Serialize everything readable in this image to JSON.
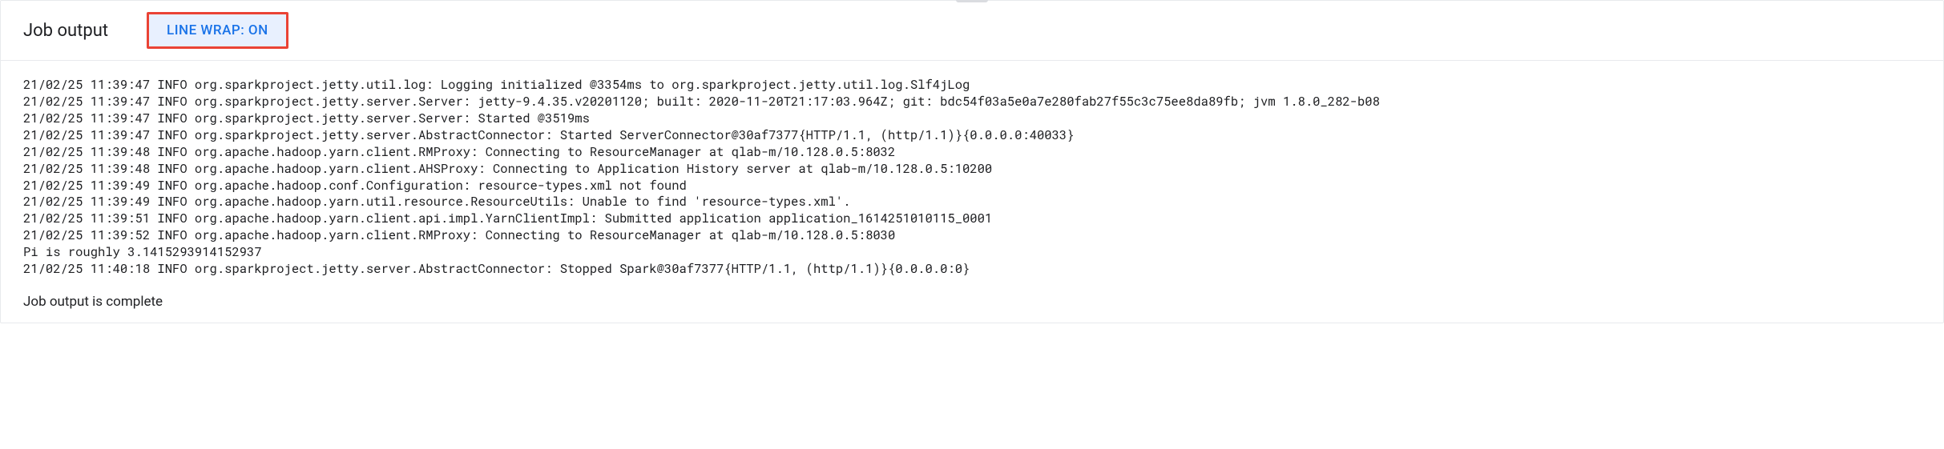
{
  "header": {
    "title": "Job output",
    "lineWrapToggleLabel": "LINE WRAP: ON"
  },
  "log": {
    "lines": [
      "21/02/25 11:39:47 INFO org.sparkproject.jetty.util.log: Logging initialized @3354ms to org.sparkproject.jetty.util.log.Slf4jLog",
      "21/02/25 11:39:47 INFO org.sparkproject.jetty.server.Server: jetty-9.4.35.v20201120; built: 2020-11-20T21:17:03.964Z; git: bdc54f03a5e0a7e280fab27f55c3c75ee8da89fb; jvm 1.8.0_282-b08",
      "21/02/25 11:39:47 INFO org.sparkproject.jetty.server.Server: Started @3519ms",
      "21/02/25 11:39:47 INFO org.sparkproject.jetty.server.AbstractConnector: Started ServerConnector@30af7377{HTTP/1.1, (http/1.1)}{0.0.0.0:40033}",
      "21/02/25 11:39:48 INFO org.apache.hadoop.yarn.client.RMProxy: Connecting to ResourceManager at qlab-m/10.128.0.5:8032",
      "21/02/25 11:39:48 INFO org.apache.hadoop.yarn.client.AHSProxy: Connecting to Application History server at qlab-m/10.128.0.5:10200",
      "21/02/25 11:39:49 INFO org.apache.hadoop.conf.Configuration: resource-types.xml not found",
      "21/02/25 11:39:49 INFO org.apache.hadoop.yarn.util.resource.ResourceUtils: Unable to find 'resource-types.xml'.",
      "21/02/25 11:39:51 INFO org.apache.hadoop.yarn.client.api.impl.YarnClientImpl: Submitted application application_1614251010115_0001",
      "21/02/25 11:39:52 INFO org.apache.hadoop.yarn.client.RMProxy: Connecting to ResourceManager at qlab-m/10.128.0.5:8030",
      "Pi is roughly 3.1415293914152937",
      "21/02/25 11:40:18 INFO org.sparkproject.jetty.server.AbstractConnector: Stopped Spark@30af7377{HTTP/1.1, (http/1.1)}{0.0.0.0:0}"
    ]
  },
  "footer": {
    "statusText": "Job output is complete"
  }
}
